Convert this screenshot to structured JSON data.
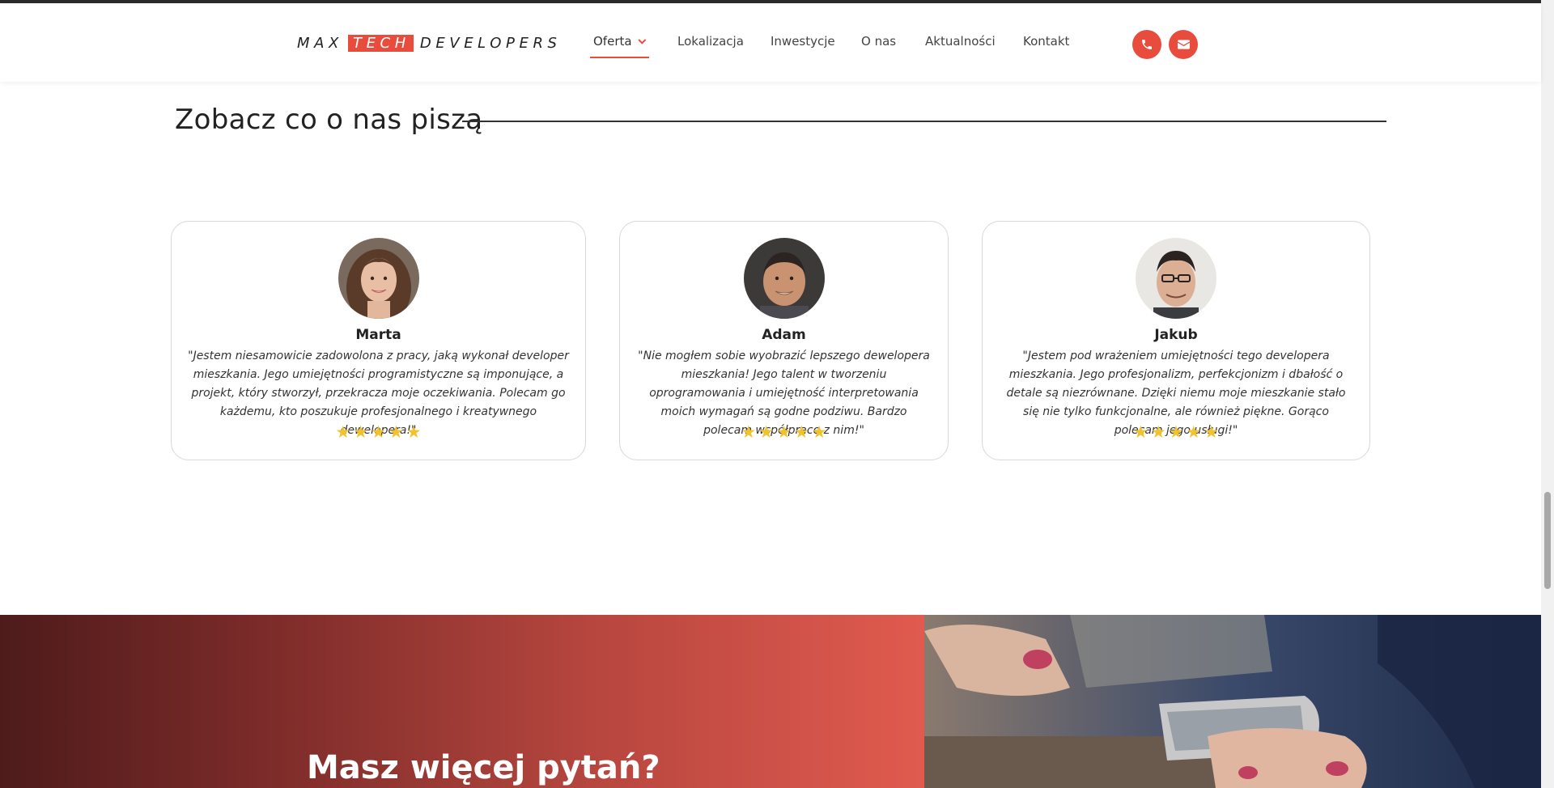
{
  "brand": {
    "part1": "MAX",
    "highlight": "TECH",
    "part2": "DEVELOPERS"
  },
  "nav": {
    "items": [
      {
        "label": "Oferta",
        "active": true,
        "dropdown": true
      },
      {
        "label": "Lokalizacja"
      },
      {
        "label": "Inwestycje"
      },
      {
        "label": "O nas"
      },
      {
        "label": "Aktualności"
      },
      {
        "label": "Kontakt"
      }
    ],
    "icons": [
      "phone-icon",
      "mail-icon"
    ]
  },
  "testimonials": {
    "title": "Zobacz co o nas piszą",
    "items": [
      {
        "name": "Marta",
        "quote": "\"Jestem niesamowicie zadowolona z pracy, jaką wykonał developer mieszkania. Jego umiejętności programistyczne są imponujące, a projekt, który stworzył, przekracza moje oczekiwania. Polecam go każdemu, kto poszukuje profesjonalnego i kreatywnego dewelopera!\"",
        "rating": 5
      },
      {
        "name": "Adam",
        "quote": "\"Nie mogłem sobie wyobrazić lepszego dewelopera mieszkania! Jego talent w tworzeniu oprogramowania i umiejętność interpretowania moich wymagań są godne podziwu. Bardzo polecam współpracę z nim!\"",
        "rating": 5
      },
      {
        "name": "Jakub",
        "quote": "\"Jestem pod wrażeniem umiejętności tego developera mieszkania. Jego profesjonalizm, perfekcjonizm i dbałość o detale są niezrównane. Dzięki niemu moje mieszkanie stało się nie tylko funkcjonalne, ale również piękne. Gorąco polecam jego usługi!\"",
        "rating": 5
      }
    ]
  },
  "cta": {
    "title": "Masz więcej pytań?"
  },
  "colors": {
    "accent": "#e84c3d",
    "star": "#f2c12e",
    "gradient_start": "#4e1b1b",
    "gradient_end": "#e05a4f"
  }
}
